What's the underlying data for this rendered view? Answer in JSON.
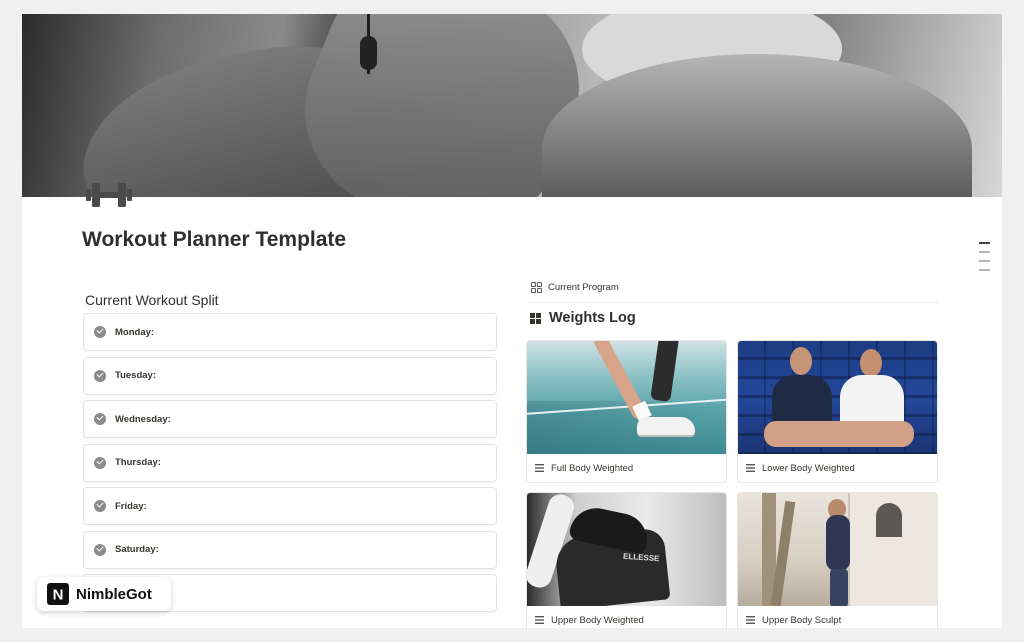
{
  "page": {
    "title": "Workout Planner Template"
  },
  "icons": {
    "page_icon": "dumbbell-icon",
    "toc": "table-of-contents-icon"
  },
  "split": {
    "title": "Current Workout Split",
    "days": [
      "Monday:",
      "Tuesday:",
      "Wednesday:",
      "Thursday:",
      "Friday:",
      "Saturday:",
      ""
    ]
  },
  "program": {
    "tab_label": "Current Program",
    "heading": "Weights Log",
    "cards": [
      {
        "label": "Full Body Weighted"
      },
      {
        "label": "Lower Body Weighted"
      },
      {
        "label": "Upper Body Weighted"
      },
      {
        "label": "Upper Body Sculpt"
      }
    ],
    "photo_text": "ELLESSE"
  },
  "brand": {
    "name": "NimbleGot",
    "logo_letter": "N"
  }
}
